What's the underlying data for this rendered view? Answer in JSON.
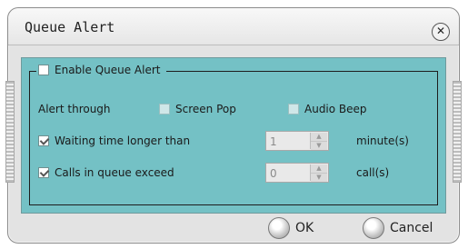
{
  "dialog": {
    "title": "Queue Alert",
    "close_icon": "close-icon"
  },
  "group": {
    "enable_label": "Enable Queue Alert",
    "enable_checked": false
  },
  "alert_through": {
    "label": "Alert through",
    "screen_pop_label": "Screen Pop",
    "screen_pop_checked": false,
    "audio_beep_label": "Audio Beep",
    "audio_beep_checked": false
  },
  "waiting": {
    "label": "Waiting time longer than",
    "checked": true,
    "value": "1",
    "unit": "minute(s)"
  },
  "calls": {
    "label": "Calls in queue exceed",
    "checked": true,
    "value": "0",
    "unit": "call(s)"
  },
  "buttons": {
    "ok_label": "OK",
    "cancel_label": "Cancel"
  },
  "colors": {
    "panel": "#74c1c5",
    "window": "#e3e3e3"
  }
}
